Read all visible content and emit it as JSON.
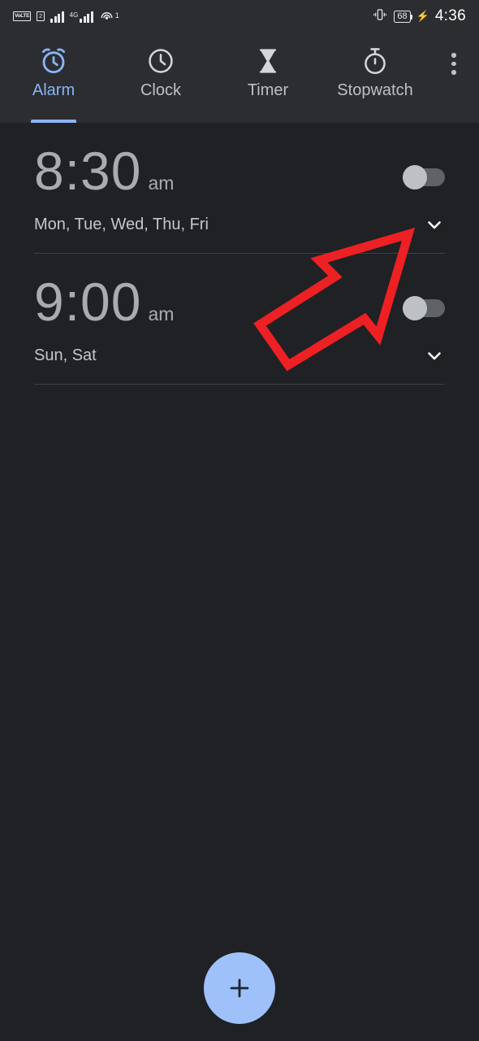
{
  "status_bar": {
    "volte_label": "VoLTE",
    "sim_label": "2",
    "network_label": "4G",
    "network_superscript": "+",
    "hotspot_superscript": "1",
    "battery_level": "68",
    "charging_icon": "bolt-icon",
    "time": "4:36"
  },
  "tabs": [
    {
      "label": "Alarm",
      "icon": "alarm-clock-icon",
      "active": true
    },
    {
      "label": "Clock",
      "icon": "clock-icon",
      "active": false
    },
    {
      "label": "Timer",
      "icon": "hourglass-icon",
      "active": false
    },
    {
      "label": "Stopwatch",
      "icon": "stopwatch-icon",
      "active": false
    }
  ],
  "overflow_menu": {
    "icon": "more-vertical-icon"
  },
  "alarms": [
    {
      "time": "8:30",
      "ampm": "am",
      "days": "Mon, Tue, Wed, Thu, Fri",
      "enabled": false,
      "expand_icon": "chevron-down-icon"
    },
    {
      "time": "9:00",
      "ampm": "am",
      "days": "Sun, Sat",
      "enabled": false,
      "expand_icon": "chevron-down-icon"
    }
  ],
  "fab": {
    "icon": "plus-icon",
    "label": "Add alarm",
    "color": "#9ec1fa"
  },
  "annotation": {
    "type": "arrow",
    "color": "#ed2024",
    "points_to": "expand-chevron-alarm-1"
  },
  "colors": {
    "accent": "#8ab4f8",
    "background": "#202124",
    "surface": "#2b2d30",
    "text_primary": "#e8eaed",
    "text_secondary": "#a8abaf"
  }
}
